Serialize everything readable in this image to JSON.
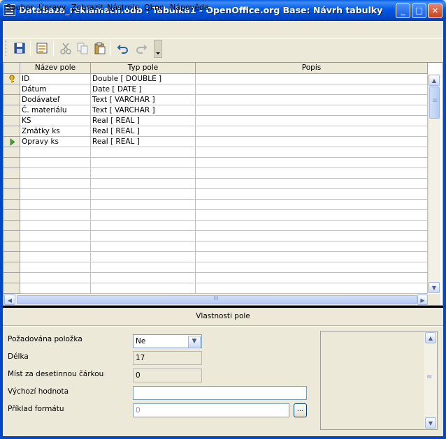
{
  "window": {
    "title": "Databaza_reklamacii.odb : Tabulka1 - OpenOffice.org Base: Návrh tabulky",
    "min_symbol": "_",
    "max_symbol": "□",
    "close_symbol": "✕"
  },
  "menu": [
    {
      "pre": "",
      "key": "S",
      "post": "oubor"
    },
    {
      "pre": "",
      "key": "Ú",
      "post": "pravy"
    },
    {
      "pre": "",
      "key": "Z",
      "post": "obrazit"
    },
    {
      "pre": "",
      "key": "N",
      "post": "ástroje"
    },
    {
      "pre": "",
      "key": "O",
      "post": "kno"
    },
    {
      "pre": "Nápov",
      "key": "ě",
      "post": "da"
    }
  ],
  "toolbar": {
    "icons": [
      "save-icon",
      "edit-icon",
      "cut-icon",
      "copy-icon",
      "paste-icon",
      "undo-icon",
      "redo-icon"
    ]
  },
  "grid": {
    "headers": [
      "Název pole",
      "Typ pole",
      "Popis"
    ],
    "rows": [
      {
        "name": "ID",
        "type": "Double [ DOUBLE ]",
        "desc": "",
        "marker": "key"
      },
      {
        "name": "Dátum",
        "type": "Date [ DATE ]",
        "desc": "",
        "marker": ""
      },
      {
        "name": "Dodávateľ",
        "type": "Text [ VARCHAR ]",
        "desc": "",
        "marker": ""
      },
      {
        "name": "Č. materiálu",
        "type": "Text [ VARCHAR ]",
        "desc": "",
        "marker": ""
      },
      {
        "name": "KS",
        "type": "Real [ REAL ]",
        "desc": "",
        "marker": ""
      },
      {
        "name": "Zmätky ks",
        "type": "Real [ REAL ]",
        "desc": "",
        "marker": ""
      },
      {
        "name": "Opravy ks",
        "type": "Real [ REAL ]",
        "desc": "",
        "marker": "current"
      }
    ],
    "hscroll_grip": "III",
    "vscroll_grip": "≡"
  },
  "properties": {
    "title": "Vlastnosti pole",
    "required_label": "Požadována položka",
    "required_value": "Ne",
    "length_label": "Délka",
    "length_value": "17",
    "decimals_label": "Míst za desetinnou čárkou",
    "decimals_value": "0",
    "default_label": "Výchozí hodnota",
    "default_value": "",
    "format_label": "Příklad formátu",
    "format_value": "0",
    "format_button": "..."
  },
  "colors": {
    "titlebar": "#0058e6",
    "face": "#ece9d8",
    "key_icon": "#e8b818",
    "current_marker": "#3fa52a"
  }
}
